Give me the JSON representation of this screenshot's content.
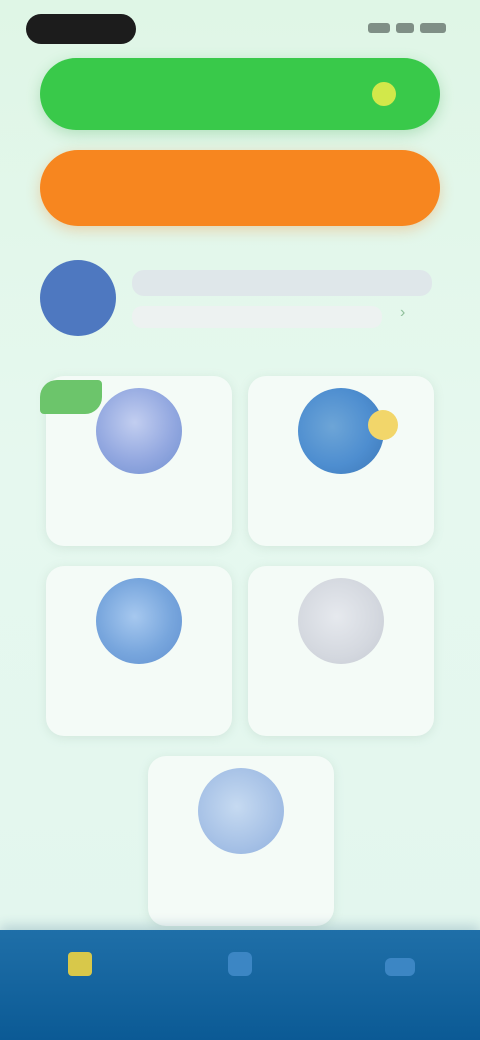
{
  "status_bar": {
    "time": "",
    "icons": [
      "signal-icon",
      "wifi-icon",
      "battery-icon"
    ]
  },
  "actions": {
    "primary_label": "",
    "secondary_label": ""
  },
  "profile": {
    "name": "",
    "subtitle": ""
  },
  "badge": {
    "text": ""
  },
  "tiles": [
    {
      "line1": "",
      "line2": "",
      "icon": "feature-1-icon"
    },
    {
      "line1": "",
      "line2": "",
      "icon": "feature-2-icon"
    },
    {
      "line1": "",
      "line2": "",
      "icon": "feature-3-icon"
    },
    {
      "line1": "",
      "line2": "",
      "icon": "feature-4-icon"
    },
    {
      "line1": "",
      "line2": "",
      "icon": "feature-5-icon"
    }
  ],
  "bottom_nav": [
    {
      "label": "",
      "icon": "home-icon"
    },
    {
      "label": "",
      "icon": "nav-icon"
    },
    {
      "label": "",
      "icon": "nav-icon"
    }
  ],
  "colors": {
    "primary_button": "#39c94a",
    "secondary_button": "#f7861f",
    "bottom_nav": "#0b5a95",
    "background": "#e2f6ee"
  }
}
